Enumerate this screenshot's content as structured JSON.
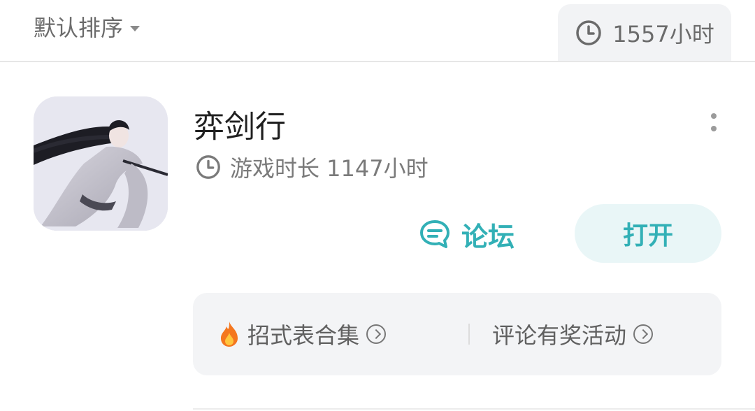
{
  "topbar": {
    "sort_label": "默认排序",
    "total_time": "1557小时"
  },
  "game": {
    "title": "弈剑行",
    "playtime_label": "游戏时长 1147小时",
    "forum_label": "论坛",
    "open_label": "打开"
  },
  "links": [
    {
      "label": "招式表合集",
      "icon": "fire-icon"
    },
    {
      "label": "评论有奖活动",
      "icon": null
    }
  ],
  "colors": {
    "accent": "#32b0b6",
    "accent_bg": "#e9f6f7",
    "card_bg": "#f3f4f6",
    "muted_text": "#7a7a7a"
  },
  "icons": {
    "sort": "caret-down-icon",
    "time": "clock-icon",
    "forum": "chat-bubble-icon",
    "more": "more-vertical-icon",
    "link_arrow": "circle-chevron-right-icon"
  }
}
